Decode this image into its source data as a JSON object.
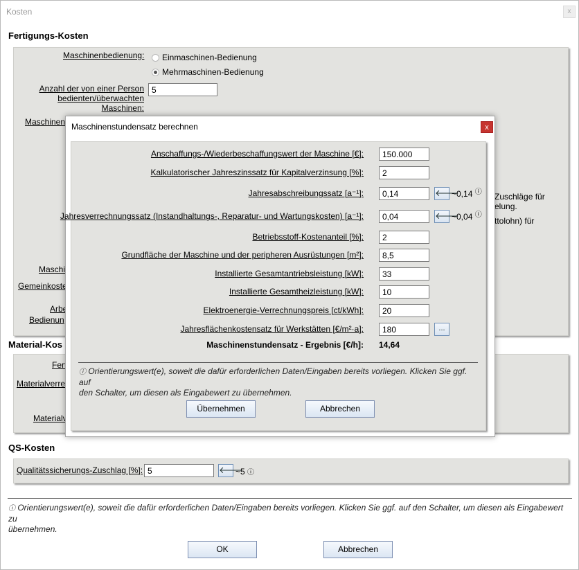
{
  "window": {
    "title": "Kosten",
    "close_glyph": "x"
  },
  "fertigung": {
    "header": "Fertigungs-Kosten",
    "maschinenbedienung_label": "Maschinenbedienung:",
    "radio_einmaschinen": "Einmaschinen-Bedienung",
    "radio_mehrmaschinen": "Mehrmaschinen-Bedienung",
    "anzahl_label_1": "Anzahl der von einer Person",
    "anzahl_label_2": "bedienten/überwachten",
    "anzahl_label_3": "Maschinen:",
    "anzahl_value": "5",
    "frag_maschinens": "Maschinens",
    "frag_maschi": "Maschi",
    "frag_gemeinkoste": "Gemeinkoste",
    "frag_arbe": "Arbe",
    "frag_bedienun": "Bedienun",
    "frag_zuschlaege": "Zuschläge für",
    "frag_elung": "elung.",
    "frag_ttolohn": "ttolohn) für"
  },
  "material": {
    "header": "Material-Kos",
    "frag_fert": "Fert",
    "frag_materialverre": "Materialverre",
    "frag_materialv": "Materialv"
  },
  "qs": {
    "header": "QS-Kosten",
    "label": "Qualitätssicherungs-Zuschlag [%]:",
    "value": "5",
    "hint": "~5"
  },
  "footer": {
    "note_line1": "Orientierungswert(e), soweit die dafür erforderlichen Daten/Eingaben bereits vorliegen. Klicken Sie ggf. auf den Schalter, um diesen als Eingabewert zu",
    "note_line2": "übernehmen.",
    "ok": "OK",
    "cancel": "Abbrechen"
  },
  "info_glyph": "ⓘ",
  "arrow_glyph": "🡐",
  "dialog": {
    "title": "Maschinenstundensatz berechnen",
    "close_glyph": "x",
    "rows": [
      {
        "label": "Anschaffungs-/Wiederbeschaffungswert der Maschine [€]:",
        "value": "150.000"
      },
      {
        "label": "Kalkulatorischer Jahreszinssatz für Kapitalverzinsung [%]:",
        "value": "2"
      },
      {
        "label": "Jahresabschreibungssatz [a⁻¹]:",
        "value": "0,14",
        "hint": "~0,14"
      },
      {
        "label": "Jahresverrechnungssatz (Instandhaltungs-, Reparatur- und Wartungskosten) [a⁻¹]:",
        "value": "0,04",
        "hint": "~0,04"
      },
      {
        "label": "Betriebsstoff-Kostenanteil [%]:",
        "value": "2"
      },
      {
        "label": "Grundfläche der Maschine und der peripheren Ausrüstungen [m²]:",
        "value": "8,5"
      },
      {
        "label": "Installierte Gesamtantriebsleistung [kW]:",
        "value": "33"
      },
      {
        "label": "Installierte Gesamtheizleistung [kW]:",
        "value": "10"
      },
      {
        "label": "Elektroenergie-Verrechnungspreis [ct/kWh]:",
        "value": "20"
      },
      {
        "label": "Jahresflächenkostensatz für Werkstätten [€/m²·a]:",
        "value": "180"
      }
    ],
    "ellipsis": "...",
    "result_label": "Maschinenstundensatz -  Ergebnis [€/h]:",
    "result_value": "14,64",
    "note_line1": "Orientierungswert(e), soweit die dafür erforderlichen Daten/Eingaben bereits vorliegen. Klicken Sie ggf. auf",
    "note_line2": "den Schalter, um diesen als Eingabewert zu übernehmen.",
    "apply": "Übernehmen",
    "cancel": "Abbrechen"
  }
}
